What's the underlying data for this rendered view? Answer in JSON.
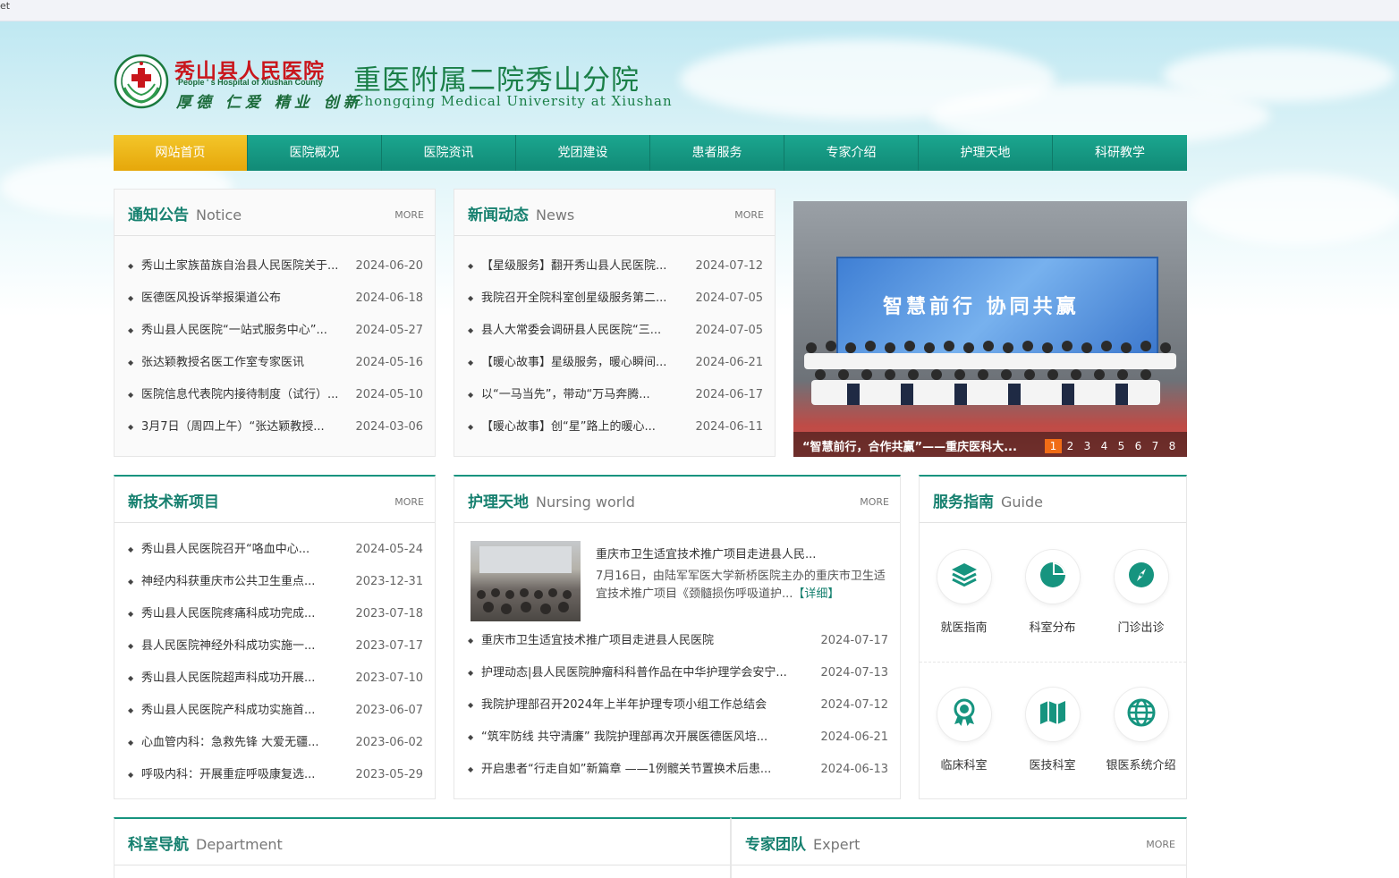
{
  "browser": {
    "tab_fragment": "et"
  },
  "header": {
    "logo_icon": "hospital-emblem-icon",
    "cn_name": "秀山县人民医院",
    "en_name": "People ' s Hospital of Xiushan County",
    "motto": "厚德 仁爱 精业 创新",
    "sub_cn": "重医附属二院秀山分院",
    "sub_en": "Chongqing Medical University at Xiushan"
  },
  "colors": {
    "accent": "#16947f",
    "active_nav": "#f3c62a",
    "title": "#16806f",
    "dot_active": "#f06c16"
  },
  "nav": [
    "网站首页",
    "医院概况",
    "医院资讯",
    "党团建设",
    "患者服务",
    "专家介绍",
    "护理天地",
    "科研教学"
  ],
  "notice": {
    "title": "通知公告",
    "sub": "Notice",
    "more": "MORE",
    "items": [
      {
        "title": "秀山土家族苗族自治县人民医院关于...",
        "date": "2024-06-20"
      },
      {
        "title": "医德医风投诉举报渠道公布",
        "date": "2024-06-18"
      },
      {
        "title": "秀山县人民医院“一站式服务中心”...",
        "date": "2024-05-27"
      },
      {
        "title": "张达颖教授名医工作室专家医讯",
        "date": "2024-05-16"
      },
      {
        "title": "医院信息代表院内接待制度（试行）...",
        "date": "2024-05-10"
      },
      {
        "title": "3月7日（周四上午）“张达颖教授...",
        "date": "2024-03-06"
      }
    ]
  },
  "news": {
    "title": "新闻动态",
    "sub": "News",
    "more": "MORE",
    "items": [
      {
        "title": "【星级服务】翻开秀山县人民医院...",
        "date": "2024-07-12"
      },
      {
        "title": "我院召开全院科室创星级服务第二...",
        "date": "2024-07-05"
      },
      {
        "title": "县人大常委会调研县人民医院“三...",
        "date": "2024-07-05"
      },
      {
        "title": "【暖心故事】星级服务，暖心瞬间...",
        "date": "2024-06-21"
      },
      {
        "title": "以“一马当先”，带动“万马奔腾...",
        "date": "2024-06-17"
      },
      {
        "title": "【暖心故事】创“星”路上的暖心...",
        "date": "2024-06-11"
      }
    ]
  },
  "carousel": {
    "banner": "智慧前行 协同共赢",
    "caption": "“智慧前行，合作共赢”——重庆医科大...",
    "pages": [
      "1",
      "2",
      "3",
      "4",
      "5",
      "6",
      "7",
      "8"
    ],
    "active": 0
  },
  "tech": {
    "title": "新技术新项目",
    "more": "MORE",
    "items": [
      {
        "title": "秀山县人民医院召开“咯血中心...",
        "date": "2024-05-24"
      },
      {
        "title": "神经内科获重庆市公共卫生重点...",
        "date": "2023-12-31"
      },
      {
        "title": "秀山县人民医院疼痛科成功完成...",
        "date": "2023-07-18"
      },
      {
        "title": "县人民医院神经外科成功实施一...",
        "date": "2023-07-17"
      },
      {
        "title": "秀山县人民医院超声科成功开展...",
        "date": "2023-07-10"
      },
      {
        "title": "秀山县人民医院产科成功实施首...",
        "date": "2023-06-07"
      },
      {
        "title": "心血管内科：急救先锋 大爱无疆...",
        "date": "2023-06-02"
      },
      {
        "title": "呼吸内科：开展重症呼吸康复选...",
        "date": "2023-05-29"
      }
    ]
  },
  "nursing": {
    "title": "护理天地",
    "sub": "Nursing world",
    "more": "MORE",
    "feature_title": "重庆市卫生适宜技术推广项目走进县人民...",
    "feature_desc": "7月16日，由陆军军医大学新桥医院主办的重庆市卫生适宜技术推广项目《颈髓损伤呼吸道护...",
    "detail": "【详细】",
    "items": [
      {
        "title": "重庆市卫生适宜技术推广项目走进县人民医院",
        "date": "2024-07-17"
      },
      {
        "title": "护理动态|县人民医院肿瘤科科普作品在中华护理学会安宁...",
        "date": "2024-07-13"
      },
      {
        "title": "我院护理部召开2024年上半年护理专项小组工作总结会",
        "date": "2024-07-12"
      },
      {
        "title": "“筑牢防线 共守清廉” 我院护理部再次开展医德医风培...",
        "date": "2024-06-21"
      },
      {
        "title": "开启患者“行走自如”新篇章 ——1例髋关节置换术后患...",
        "date": "2024-06-13"
      }
    ]
  },
  "guide": {
    "title": "服务指南",
    "sub": "Guide",
    "items": [
      {
        "label": "就医指南",
        "icon": "layers-icon"
      },
      {
        "label": "科室分布",
        "icon": "pie-chart-icon"
      },
      {
        "label": "门诊出诊",
        "icon": "compass-icon"
      },
      {
        "label": "临床科室",
        "icon": "award-badge-icon"
      },
      {
        "label": "医技科室",
        "icon": "map-icon"
      },
      {
        "label": "银医系统介绍",
        "icon": "globe-icon"
      }
    ]
  },
  "department": {
    "title": "科室导航",
    "sub": "Department"
  },
  "expert": {
    "title": "专家团队",
    "sub": "Expert",
    "more": "MORE"
  }
}
